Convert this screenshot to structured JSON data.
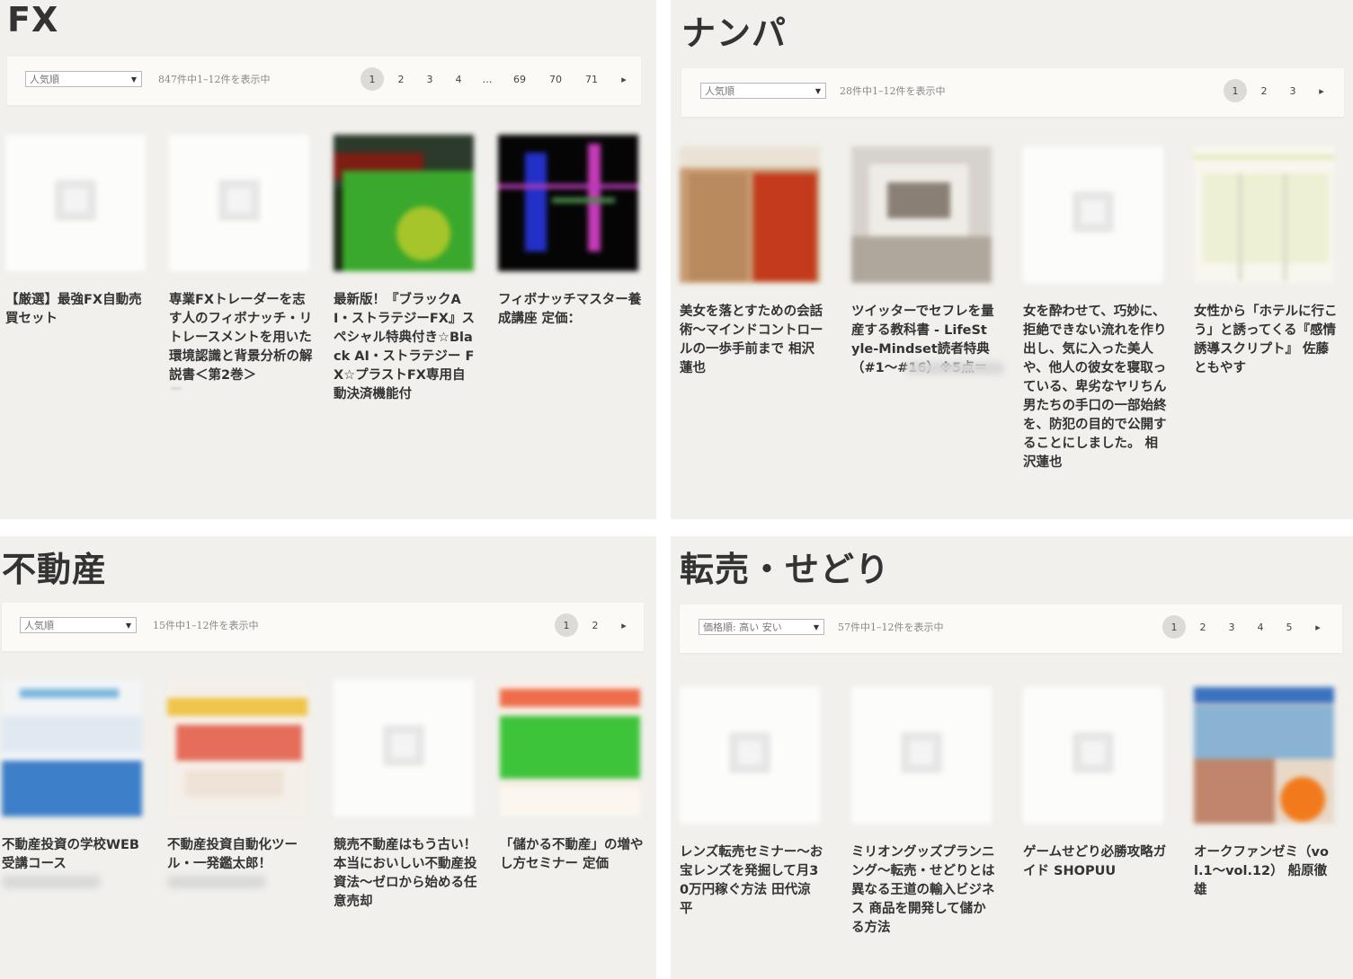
{
  "sections": {
    "fx": {
      "title": "FX",
      "sort": "人気順",
      "count": "847件中1–12件を表示中",
      "pages": [
        "1",
        "2",
        "3",
        "4",
        "…",
        "69",
        "70",
        "71",
        "▸"
      ],
      "products": [
        {
          "name": "【厳選】最強FX自動売買セット"
        },
        {
          "name": "専業FXトレーダーを志す人のフィボナッチ・リトレースメントを用いた環境認識と背景分析の解説書＜第2巻＞"
        },
        {
          "name": "最新版！『ブラックAI・ストラテジーFX』スペシャル特典付き☆Black AI・ストラテジー FX☆プラストFX専用自動決済機能付"
        },
        {
          "name": "フィボナッチマスター養成講座 定価："
        }
      ]
    },
    "nanpa": {
      "title": "ナンパ",
      "sort": "人気順",
      "count": "28件中1–12件を表示中",
      "pages": [
        "1",
        "2",
        "3",
        "▸"
      ],
      "products": [
        {
          "name": "美女を落とすための会話術～マインドコントロールの一歩手前まで 相沢蓮也"
        },
        {
          "name": "ツイッターでセフレを量産する教科書 - LifeStyle-Mindset読者特典（#1～#16）※5点＝"
        },
        {
          "name": "女を酔わせて、巧妙に、拒絶できない流れを作り出し、気に入った美人や、他人の彼女を寝取っている、卑劣なヤリちん男たちの手口の一部始終を、防犯の目的で公開することにしました。 相沢蓮也"
        },
        {
          "name": "女性から「ホテルに行こう」と誘ってくる『感情誘導スクリプト』 佐藤ともやす"
        }
      ]
    },
    "realestate": {
      "title": "不動産",
      "sort": "人気順",
      "count": "15件中1–12件を表示中",
      "pages": [
        "1",
        "2",
        "▸"
      ],
      "products": [
        {
          "name": "不動産投資の学校WEB受講コース"
        },
        {
          "name": "不動産投資自動化ツール・一発鑑太郎！"
        },
        {
          "name": "競売不動産はもう古い！本当においしい不動産投資法～ゼロから始める任意売却"
        },
        {
          "name": "「儲かる不動産」の増やし方セミナー 定価"
        }
      ]
    },
    "resale": {
      "title": "転売・せどり",
      "sort": "価格順: 高い 安い",
      "count": "57件中1–12件を表示中",
      "pages": [
        "1",
        "2",
        "3",
        "4",
        "5",
        "▸"
      ],
      "products": [
        {
          "name": "レンズ転売セミナー～お宝レンズを発掘して月30万円稼ぐ方法 田代涼平"
        },
        {
          "name": "ミリオングッズプランニング～転売・せどりとは異なる王道の輸入ビジネス 商品を開発して儲かる方法"
        },
        {
          "name": "ゲームせどり必勝攻略ガイド SHOPUU"
        },
        {
          "name": "オークファンゼミ（vol.1～vol.12） 船原徹雄"
        }
      ]
    }
  },
  "icons": {
    "placeholder": "image-placeholder-icon",
    "next": "chevron-right-icon",
    "caret": "caret-down-icon"
  }
}
